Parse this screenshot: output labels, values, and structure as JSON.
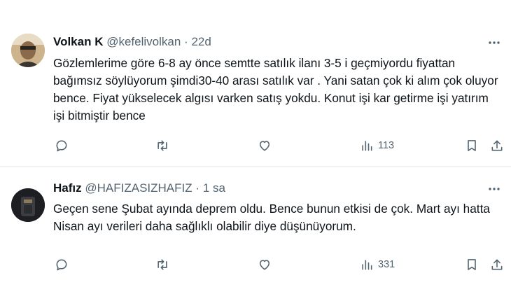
{
  "tweets": [
    {
      "display_name": "Volkan K",
      "handle": "@kefelivolkan",
      "separator": "·",
      "time": "22d",
      "text": "Gözlemlerime göre 6-8 ay önce semtte satılık ilanı 3-5 i geçmiyordu fiyattan bağımsız söylüyorum şimdi30-40 arası satılık var . Yani satan çok ki alım çok oluyor bence. Fiyat yükselecek algısı varken satış yokdu. Konut işi kar getirme işi yatırım işi bitmiştir bence",
      "views": "113"
    },
    {
      "display_name": "Hafız",
      "handle": "@HAFIZASIZHAFIZ",
      "separator": "·",
      "time": "1 sa",
      "text": "Geçen sene Şubat ayında deprem oldu. Bence bunun etkisi de çok. Mart ayı hatta Nisan ayı verileri daha sağlıklı olabilir diye düşünüyorum.",
      "views": "331"
    }
  ],
  "colors": {
    "text": "#0f1419",
    "secondary": "#536471",
    "divider": "#eff3f4"
  },
  "icons": [
    "more-icon",
    "reply-icon",
    "retweet-icon",
    "like-icon",
    "views-icon",
    "bookmark-icon",
    "share-icon"
  ]
}
